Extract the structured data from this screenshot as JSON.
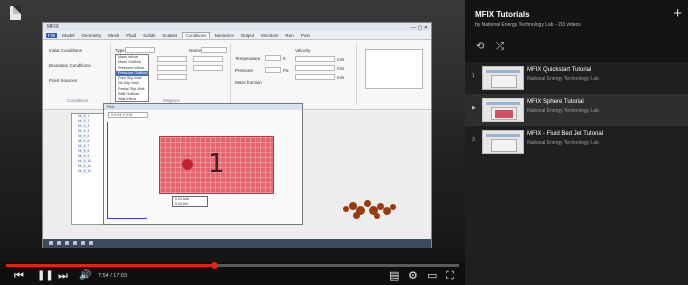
{
  "player": {
    "time_display": "7:54 / 17:03",
    "progress": 0.46,
    "controls": {
      "prev": "⏮",
      "pause": "❚❚",
      "next": "⏭",
      "volume": "🔊",
      "captions": "▤",
      "settings": "⚙",
      "theater": "▭",
      "fullscreen": "⛶"
    },
    "accent_color": "#e62117"
  },
  "video_content": {
    "app_tabs": [
      "File",
      "Model",
      "Geometry",
      "Mesh",
      "Fluid",
      "Solids",
      "Scalars",
      "Conditions",
      "Numerics",
      "Output",
      "Monitors",
      "Run",
      "Post"
    ],
    "active_tab": "Conditions",
    "ribbon": {
      "initial_conditions": "Initial Conditions",
      "boundary_conditions": "Boundary Conditions",
      "point_sources": "Point Sources",
      "conditions_group": "Conditions",
      "type_label": "Type",
      "name_label": "Name",
      "regions_label": "Regions",
      "temperature": "Temperature",
      "pressure": "Pressure",
      "velocity": "Velocity",
      "mass_fraction": "Mass fraction",
      "units_ms": "m/s",
      "units_k": "K",
      "units_pa": "Pa"
    },
    "dropdown_options": [
      "Mass Inflow",
      "Mass Outflow",
      "Pressure Inflow",
      "Pressure Outflow",
      "Free Slip Wall",
      "No Slip Wall",
      "Partial Slip Wall",
      "Wall Outflow",
      "Wall Inflow"
    ],
    "dropdown_selected": "Pressure Outflow",
    "plot_window_title": "Plot",
    "plot_toolbar": "X 0.24 Y 0.01",
    "marker_label": "1",
    "popup_lines": [
      "0.04 Add",
      "0.05 Del"
    ],
    "tree_items": [
      "Nr_fl_1",
      "Nr_fl_2",
      "Nr_fl_3",
      "Nr_fl_4",
      "Nr_fl_5",
      "Nr_fl_6",
      "Nr_fl_7",
      "Nr_fl_8",
      "Nr_fl_9",
      "Nr_fl_10",
      "Nr_fl_11",
      "Nr_fl_12"
    ]
  },
  "playlist": {
    "title": "MFIX Tutorials",
    "subtitle": "by National Energy Technology Lab - 2/3 videos",
    "add_icon": "+",
    "loop_icon": "⟲",
    "shuffle_icon": "⤮",
    "items": [
      {
        "index": "1",
        "name": "MFIX Quickstart Tutorial",
        "author": "National Energy Technology Lab",
        "active": false
      },
      {
        "index": "▶",
        "name": "MFIX Sphere Tutorial",
        "author": "National Energy Technology Lab",
        "active": true
      },
      {
        "index": "3",
        "name": "MFIX - Fluid Bed Jet Tutorial",
        "author": "National Energy Technology Lab",
        "active": false
      }
    ]
  }
}
